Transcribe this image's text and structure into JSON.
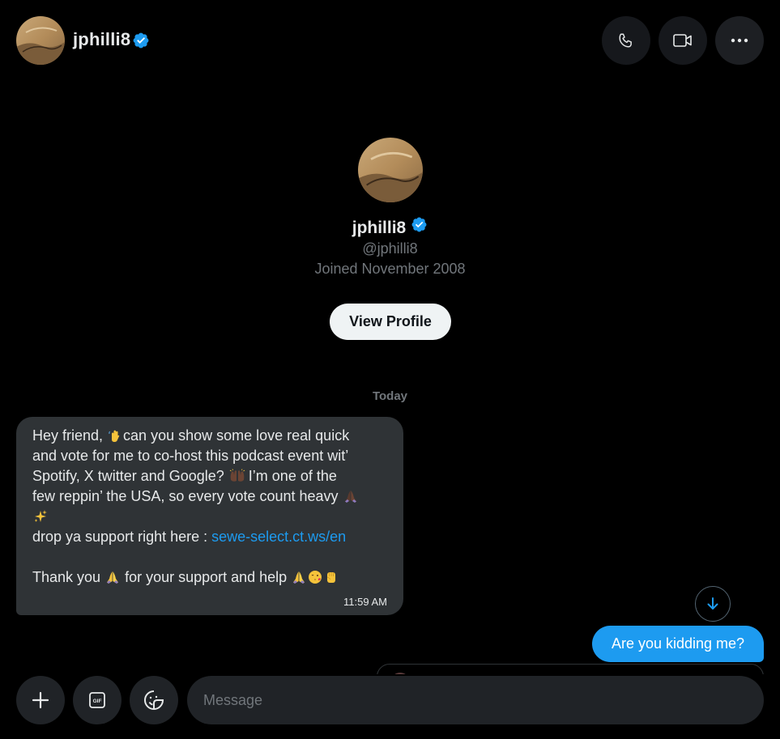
{
  "header": {
    "username": "jphilli8",
    "call_button": "phone-icon",
    "video_button": "video-icon",
    "more_button": "more-icon"
  },
  "profile": {
    "display_name": "jphilli8",
    "handle": "@jphilli8",
    "joined": "Joined November 2008",
    "view_profile_label": "View Profile"
  },
  "conversation": {
    "date_separator": "Today",
    "incoming": {
      "lines": [
        {
          "before": "Hey friend, ",
          "after": "can you show some love real quick"
        },
        {
          "text": "and vote for me to co-host this podcast event wit’"
        },
        {
          "before": "Spotify, X twitter and Google? ",
          "after": " I’m one of the"
        },
        {
          "before": "few reppin’ the USA, so every vote count heavy ",
          "after": ""
        },
        {
          "text": ""
        },
        {
          "before": "drop ya support right here : ",
          "link": "sewe-select.ct.ws/en"
        },
        {
          "text": ""
        },
        {
          "before": "Thank you ",
          "after": " for your support and help "
        }
      ],
      "time": "11:59 AM"
    },
    "outgoing": {
      "text": "Are you kidding me?"
    }
  },
  "composer": {
    "placeholder": "Message",
    "value": "",
    "plus_icon": "plus-icon",
    "gif_icon": "gif-icon",
    "gif_label": "GIF",
    "sticker_icon": "emoji-icon"
  },
  "colors": {
    "background": "#000000",
    "accent": "#1d9bf0",
    "bubble_in": "#2f3336",
    "secondary_text": "#71767b",
    "verified": "#1d9bf0"
  }
}
